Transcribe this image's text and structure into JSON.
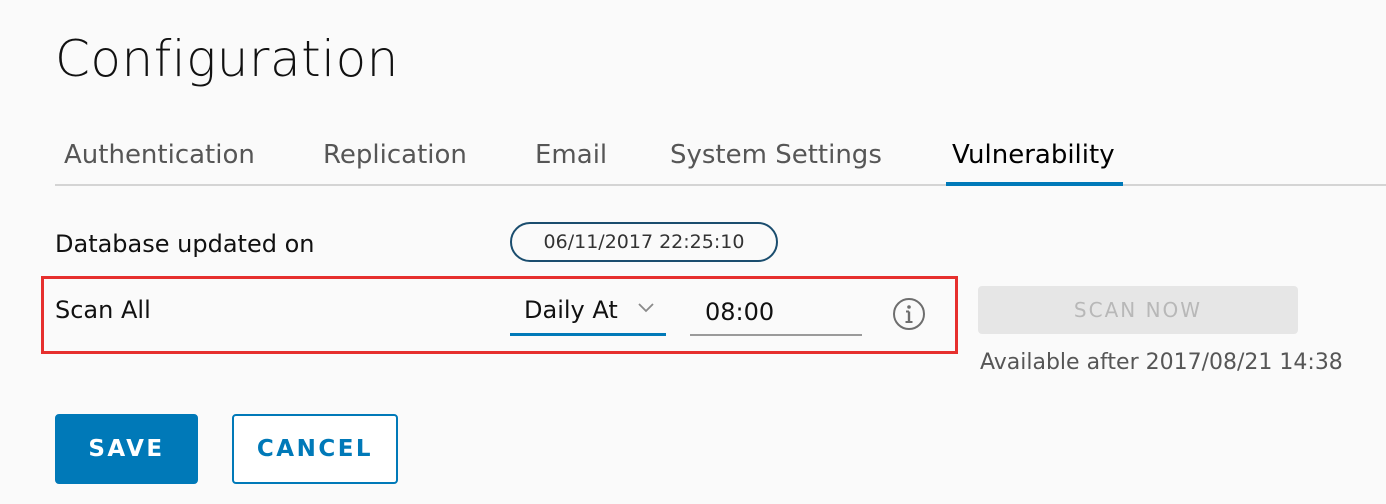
{
  "page": {
    "title": "Configuration"
  },
  "tabs": [
    {
      "label": "Authentication",
      "active": false
    },
    {
      "label": "Replication",
      "active": false
    },
    {
      "label": "Email",
      "active": false
    },
    {
      "label": "System Settings",
      "active": false
    },
    {
      "label": "Vulnerability",
      "active": true
    }
  ],
  "database": {
    "label": "Database updated on",
    "timestamp": "06/11/2017 22:25:10"
  },
  "scan_all": {
    "label": "Scan All",
    "schedule_selected": "Daily At",
    "time_value": "08:00",
    "info_icon": "info-circle-icon"
  },
  "scan_now": {
    "label": "SCAN NOW",
    "disabled": true,
    "available_text": "Available after 2017/08/21 14:38"
  },
  "actions": {
    "save_label": "SAVE",
    "cancel_label": "CANCEL"
  },
  "colors": {
    "accent": "#0079b8",
    "highlight": "#e6302e",
    "pill_border": "#1a4d6e",
    "disabled_bg": "#e6e6e6",
    "disabled_text": "#b8b8b8"
  }
}
